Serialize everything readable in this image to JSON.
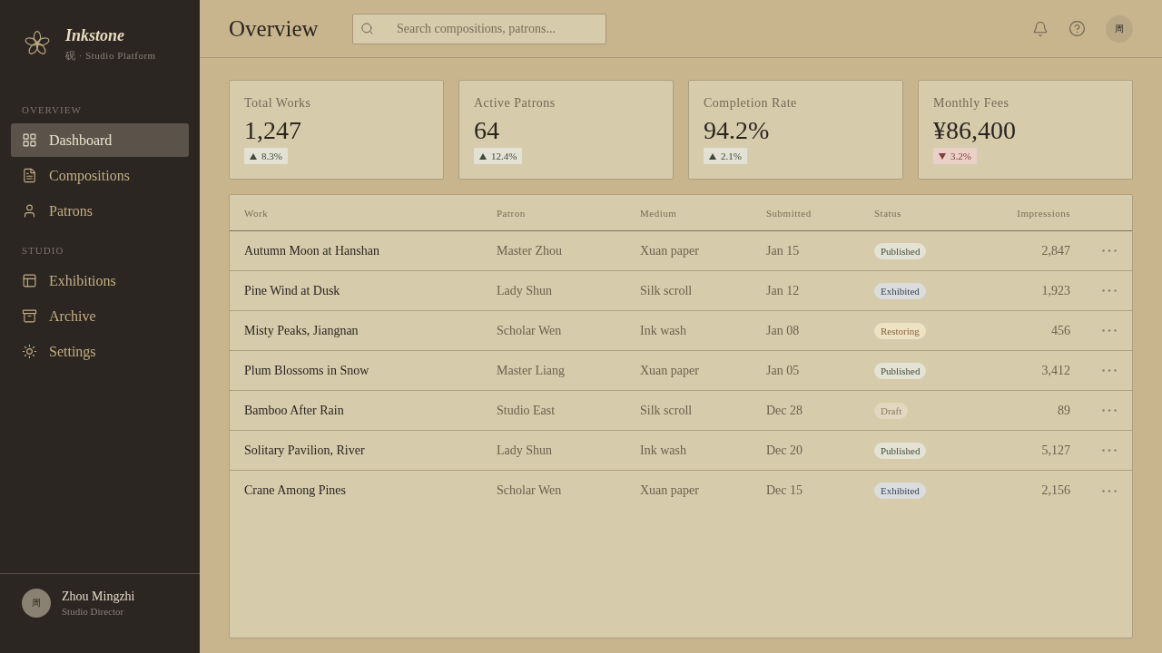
{
  "sidebar": {
    "brand": {
      "name": "Inkstone",
      "tagline": "砚 · Studio Platform"
    },
    "sections": [
      {
        "title": "OVERVIEW",
        "items": [
          {
            "label": "Dashboard",
            "selected": true
          },
          {
            "label": "Compositions",
            "selected": false
          },
          {
            "label": "Patrons",
            "selected": false
          }
        ]
      },
      {
        "title": "STUDIO",
        "items": [
          {
            "label": "Exhibitions",
            "selected": false
          },
          {
            "label": "Archive",
            "selected": false
          },
          {
            "label": "Settings",
            "selected": false
          }
        ]
      }
    ],
    "user": {
      "avatar": "周",
      "name": "Zhou Mingzhi",
      "role": "Studio Director"
    }
  },
  "header": {
    "title": "Overview",
    "search": {
      "placeholder": "Search compositions, patrons..."
    },
    "avatar": "周"
  },
  "stats": [
    {
      "label": "Total Works",
      "value": "1,247",
      "change": "8.3%",
      "kind": "up"
    },
    {
      "label": "Active Patrons",
      "value": "64",
      "change": "12.4%",
      "kind": "up"
    },
    {
      "label": "Completion Rate",
      "value": "94.2%",
      "change": "2.1%",
      "kind": "up"
    },
    {
      "label": "Monthly Fees",
      "value": "¥86,400",
      "change": "3.2%",
      "kind": "down"
    }
  ],
  "table": {
    "columns": [
      "Work",
      "Patron",
      "Medium",
      "Submitted",
      "Status",
      "Impressions"
    ],
    "rows": [
      {
        "work": "Autumn Moon at Hanshan",
        "patron": "Master Zhou",
        "medium": "Xuan paper",
        "submitted": "Jan 15",
        "status": {
          "label": "Published",
          "kind": "published"
        },
        "impressions": "2,847"
      },
      {
        "work": "Pine Wind at Dusk",
        "patron": "Lady Shun",
        "medium": "Silk scroll",
        "submitted": "Jan 12",
        "status": {
          "label": "Exhibited",
          "kind": "exhibited"
        },
        "impressions": "1,923"
      },
      {
        "work": "Misty Peaks, Jiangnan",
        "patron": "Scholar Wen",
        "medium": "Ink wash",
        "submitted": "Jan 08",
        "status": {
          "label": "Restoring",
          "kind": "restoring"
        },
        "impressions": "456"
      },
      {
        "work": "Plum Blossoms in Snow",
        "patron": "Master Liang",
        "medium": "Xuan paper",
        "submitted": "Jan 05",
        "status": {
          "label": "Published",
          "kind": "published"
        },
        "impressions": "3,412"
      },
      {
        "work": "Bamboo After Rain",
        "patron": "Studio East",
        "medium": "Silk scroll",
        "submitted": "Dec 28",
        "status": {
          "label": "Draft",
          "kind": "draft"
        },
        "impressions": "89"
      },
      {
        "work": "Solitary Pavilion, River",
        "patron": "Lady Shun",
        "medium": "Ink wash",
        "submitted": "Dec 20",
        "status": {
          "label": "Published",
          "kind": "published"
        },
        "impressions": "5,127"
      },
      {
        "work": "Crane Among Pines",
        "patron": "Scholar Wen",
        "medium": "Xuan paper",
        "submitted": "Dec 15",
        "status": {
          "label": "Exhibited",
          "kind": "exhibited"
        },
        "impressions": "2,156"
      }
    ]
  }
}
